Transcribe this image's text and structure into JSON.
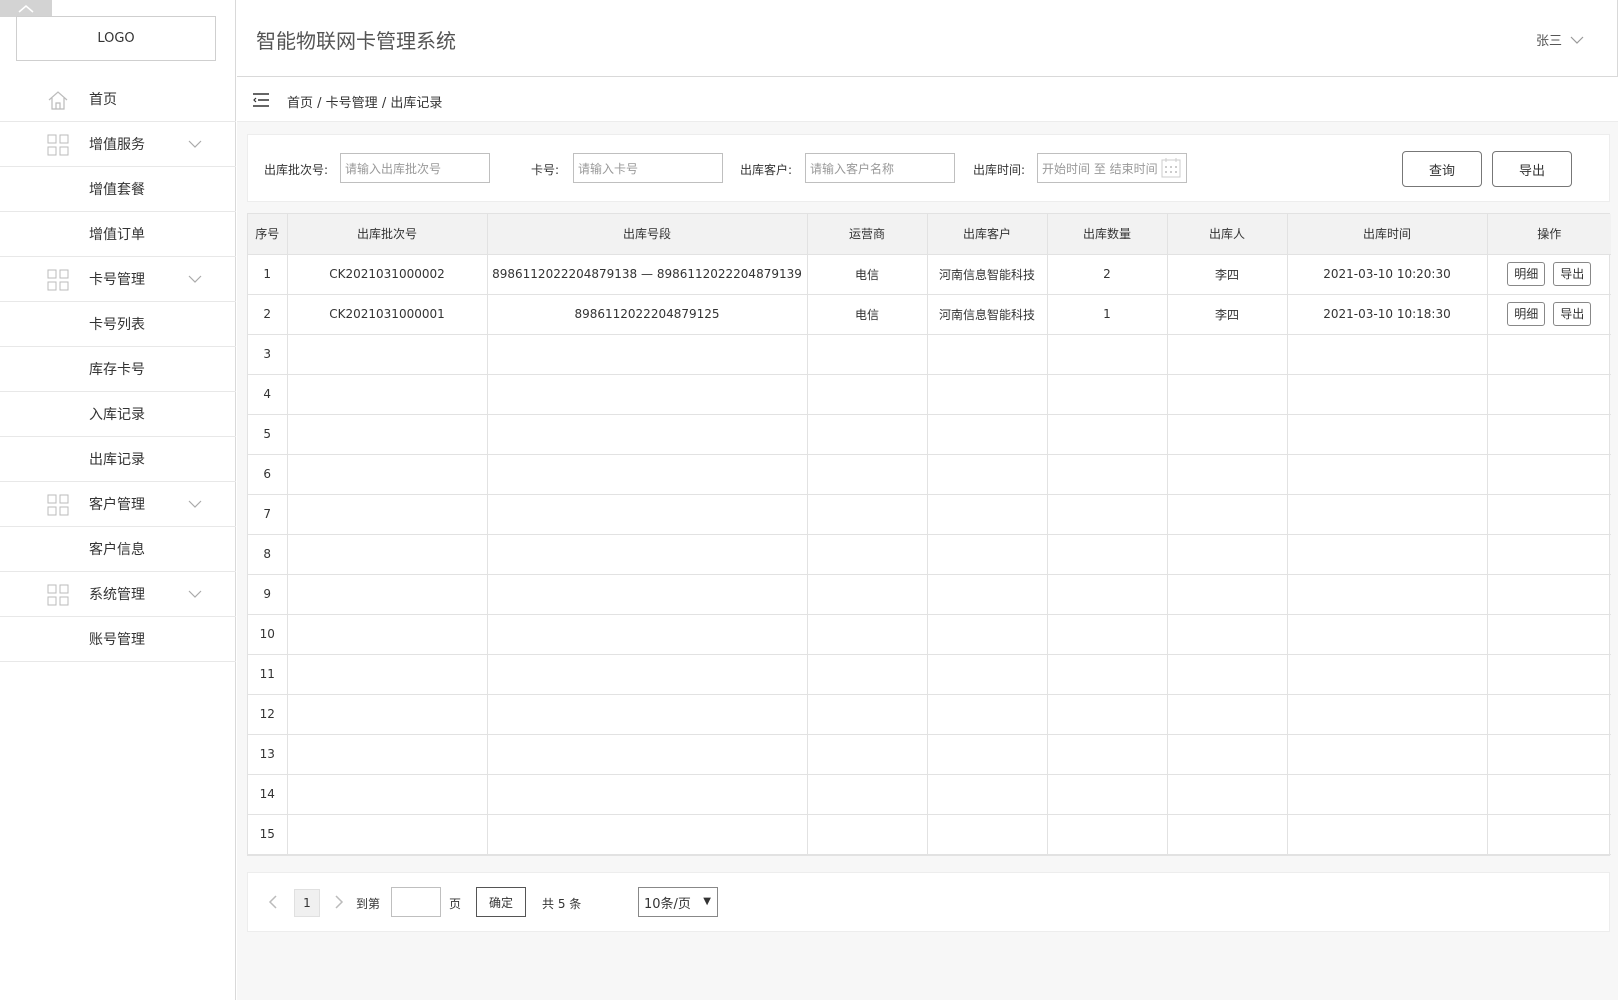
{
  "logo": {
    "text": "LOGO"
  },
  "header": {
    "title": "智能物联网卡管理系统",
    "user": "张三"
  },
  "sidebar": {
    "items": [
      {
        "label": "首页"
      },
      {
        "label": "增值服务"
      },
      {
        "label": "增值套餐"
      },
      {
        "label": "增值订单"
      },
      {
        "label": "卡号管理"
      },
      {
        "label": "卡号列表"
      },
      {
        "label": "库存卡号"
      },
      {
        "label": "入库记录"
      },
      {
        "label": "出库记录"
      },
      {
        "label": "客户管理"
      },
      {
        "label": "客户信息"
      },
      {
        "label": "系统管理"
      },
      {
        "label": "账号管理"
      }
    ]
  },
  "breadcrumb": {
    "home": "首页",
    "sep": " / ",
    "section": "卡号管理",
    "current": "出库记录"
  },
  "filters": {
    "batch_label": "出库批次号:",
    "batch_placeholder": "请输入出库批次号",
    "card_label": "卡号:",
    "card_placeholder": "请输入卡号",
    "customer_label": "出库客户:",
    "customer_placeholder": "请输入客户名称",
    "time_label": "出库时间:",
    "time_placeholder": "开始时间 至 结束时间",
    "query_button": "查询",
    "export_button": "导出"
  },
  "table": {
    "headers": [
      "序号",
      "出库批次号",
      "出库号段",
      "运营商",
      "出库客户",
      "出库数量",
      "出库人",
      "出库时间",
      "操作"
    ],
    "rows": [
      {
        "idx": "1",
        "batch": "CK2021031000002",
        "range": "8986112022204879138 — 8986112022204879139",
        "carrier": "电信",
        "customer": "河南信息智能科技",
        "qty": "2",
        "operator": "李四",
        "time": "2021-03-10 10:20:30"
      },
      {
        "idx": "2",
        "batch": "CK2021031000001",
        "range": "8986112022204879125",
        "carrier": "电信",
        "customer": "河南信息智能科技",
        "qty": "1",
        "operator": "李四",
        "time": "2021-03-10 10:18:30"
      },
      {
        "idx": "3"
      },
      {
        "idx": "4"
      },
      {
        "idx": "5"
      },
      {
        "idx": "6"
      },
      {
        "idx": "7"
      },
      {
        "idx": "8"
      },
      {
        "idx": "9"
      },
      {
        "idx": "10"
      },
      {
        "idx": "11"
      },
      {
        "idx": "12"
      },
      {
        "idx": "13"
      },
      {
        "idx": "14"
      },
      {
        "idx": "15"
      }
    ],
    "detail_label": "明细",
    "export_label": "导出"
  },
  "pagination": {
    "current_page": "1",
    "goto_label": "到第",
    "page_suffix": "页",
    "confirm_label": "确定",
    "total_text": "共 5 条",
    "page_size": "10条/页"
  }
}
